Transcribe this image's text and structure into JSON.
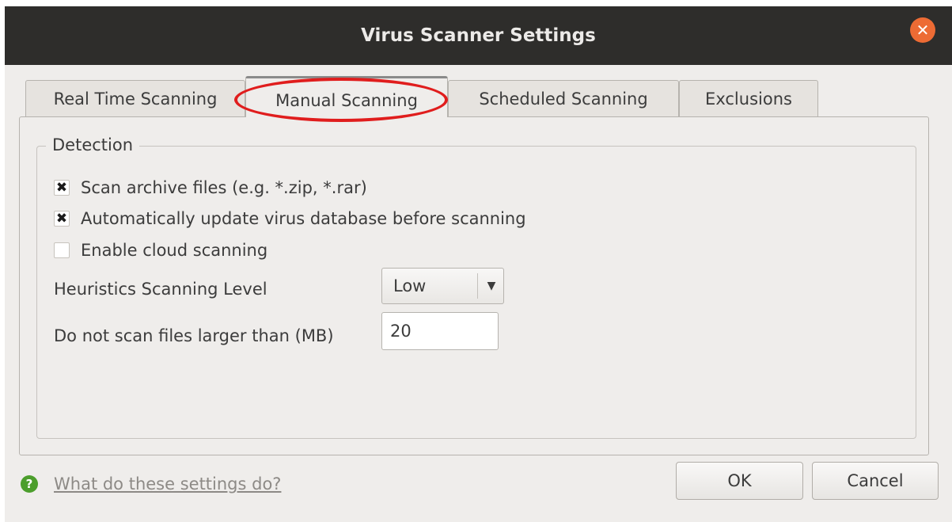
{
  "window": {
    "title": "Virus Scanner Settings"
  },
  "tabs": [
    {
      "label": "Real Time Scanning"
    },
    {
      "label": "Manual Scanning",
      "active": true
    },
    {
      "label": "Scheduled Scanning"
    },
    {
      "label": "Exclusions"
    }
  ],
  "detection": {
    "group_label": "Detection",
    "options": [
      {
        "label": "Scan archive files (e.g. *.zip, *.rar)",
        "checked": true
      },
      {
        "label": "Automatically update virus database before scanning",
        "checked": true
      },
      {
        "label": "Enable cloud scanning",
        "checked": false
      }
    ],
    "heuristics": {
      "label": "Heuristics Scanning Level",
      "value": "Low"
    },
    "max_size": {
      "label": "Do not scan files larger than (MB)",
      "value": "20"
    }
  },
  "footer": {
    "help_link": "What do these settings do?",
    "ok_label": "OK",
    "cancel_label": "Cancel"
  },
  "glyphs": {
    "check": "✖",
    "close": "✕",
    "dropdown": "▼",
    "help": "?"
  },
  "colors": {
    "titlebar": "#2e2d2b",
    "close_button": "#ed6b34",
    "highlight_ring": "#e01d1d",
    "help_icon": "#4c9e2c"
  }
}
